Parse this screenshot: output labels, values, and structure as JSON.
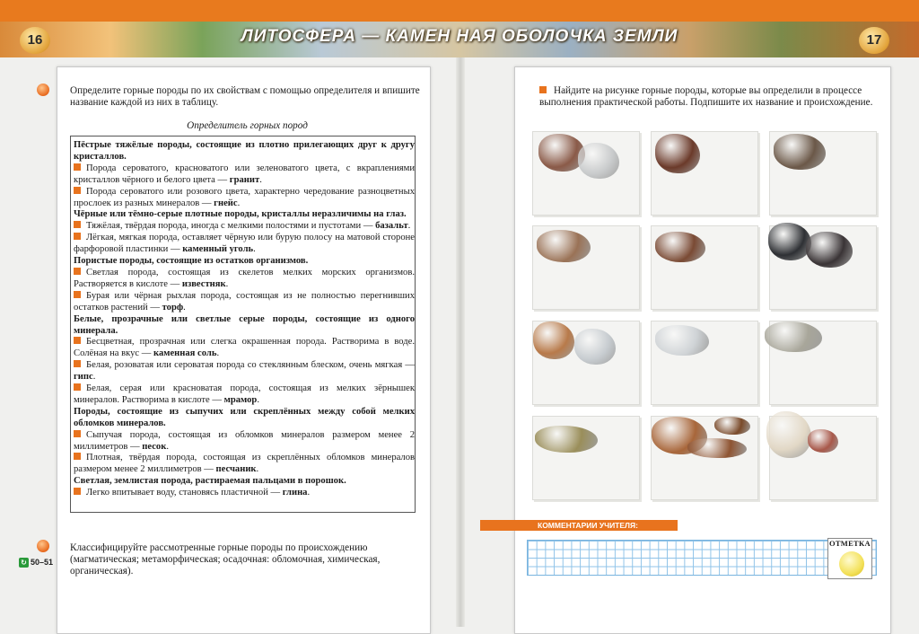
{
  "header": {
    "title": "ЛИТОСФЕРА — КАМЕН  НАЯ ОБОЛОЧКА ЗЕМЛИ",
    "page_left": "16",
    "page_right": "17"
  },
  "left_page": {
    "task1": "Определите горные породы по их свойствам с помощью определителя и впишите название каждой из них в таблицу.",
    "guide_title": "Определитель горных пород",
    "guide": [
      {
        "type": "head",
        "text": "Пёстрые тяжёлые породы, состоящие из плотно прилегающих друг к другу кристаллов."
      },
      {
        "type": "item",
        "text": "Порода сероватого, красноватого или зеленоватого цвета, с вкраплениями кристаллов чёрного и белого цвета — ",
        "answer": "гранит",
        "end": "."
      },
      {
        "type": "item",
        "text": "Порода сероватого или розового цвета, характерно чередование разноцветных прослоек из разных минералов — ",
        "answer": "гнейс",
        "end": "."
      },
      {
        "type": "head",
        "text": "Чёрные или тёмно-серые плотные породы, кристаллы неразличимы на глаз."
      },
      {
        "type": "item",
        "text": "Тяжёлая, твёрдая порода, иногда с мелкими полостями и пустотами — ",
        "answer": "базальт",
        "end": "."
      },
      {
        "type": "item",
        "text": "Лёгкая, мягкая порода, оставляет чёрную или бурую полосу на матовой стороне фарфоровой пластинки — ",
        "answer": "каменный уголь",
        "end": "."
      },
      {
        "type": "head",
        "text": "Пористые породы, состоящие из остатков организмов."
      },
      {
        "type": "item",
        "text": "Светлая порода, состоящая из скелетов мелких морских организмов. Растворяется в кислоте — ",
        "answer": "известняк",
        "end": "."
      },
      {
        "type": "item",
        "text": "Бурая или чёрная рыхлая порода, состоящая из не полностью перегнивших остатков растений — ",
        "answer": "торф",
        "end": "."
      },
      {
        "type": "head",
        "text": "Белые, прозрачные или светлые серые породы, состоящие из одного минерала."
      },
      {
        "type": "item",
        "text": "Бесцветная, прозрачная или слегка окрашенная порода. Растворима в воде. Солёная на вкус — ",
        "answer": "каменная соль",
        "end": "."
      },
      {
        "type": "item",
        "text": "Белая, розоватая или сероватая порода со стеклянным блеском, очень мягкая — ",
        "answer": "гипс",
        "end": "."
      },
      {
        "type": "item",
        "text": "Белая, серая или красноватая порода, состоящая из мелких зёрнышек минералов. Растворима в кислоте — ",
        "answer": "мрамор",
        "end": "."
      },
      {
        "type": "head",
        "text": "Породы, состоящие из сыпучих или скреплённых между собой мелких обломков минералов."
      },
      {
        "type": "item",
        "text": "Сыпучая порода, состоящая из обломков минералов размером менее 2 миллиметров — ",
        "answer": "песок",
        "end": "."
      },
      {
        "type": "item",
        "text": "Плотная, твёрдая порода, состоящая из скреплённых обломков минералов размером менее 2 миллиметров — ",
        "answer": "песчаник",
        "end": "."
      },
      {
        "type": "head",
        "text": "Светлая, землистая порода, растираемая пальцами в порошок."
      },
      {
        "type": "item",
        "text": "Легко впитывает воду, становясь пластичной — ",
        "answer": "глина",
        "end": "."
      }
    ],
    "task2": "Классифицируйте рассмотренные горные породы по происхождению (магматическая; метаморфическая; осадочная: обломочная, химическая, органическая).",
    "page_ref": "50–51"
  },
  "right_page": {
    "task": "Найдите на рисунке горные породы, которые вы определили в процессе выполнения практической работы. Подпишите их название и происхождение.",
    "comment_label": "КОММЕНТАРИИ УЧИТЕЛЯ:",
    "mark_label": "ОТМЕТКА"
  },
  "colors": {
    "accent": "#e8731e",
    "grid_line": "#8fc3e8"
  }
}
